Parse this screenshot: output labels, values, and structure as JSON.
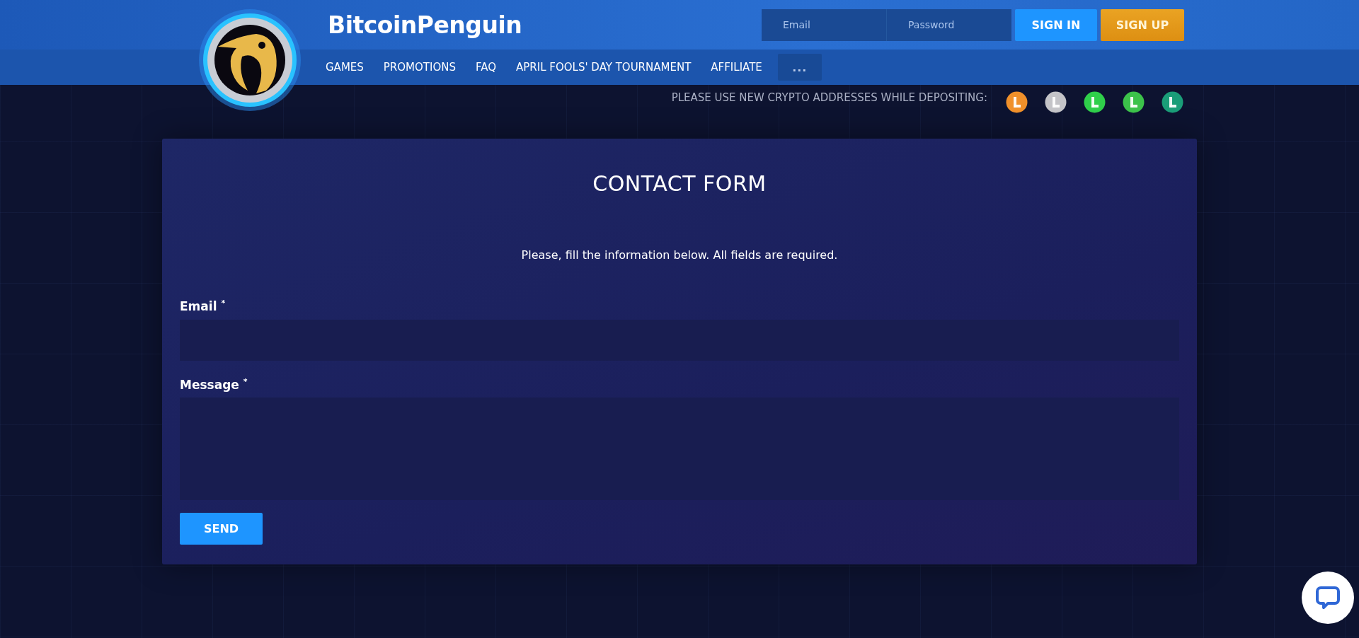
{
  "header": {
    "brand": "BitcoinPenguin",
    "login": {
      "email_placeholder": "Email",
      "password_placeholder": "Password",
      "sign_in": "SIGN IN",
      "sign_up": "SIGN UP"
    },
    "nav": [
      {
        "label": "GAMES"
      },
      {
        "label": "PROMOTIONS"
      },
      {
        "label": "FAQ"
      },
      {
        "label": "APRIL FOOLS' DAY TOURNAMENT"
      },
      {
        "label": "AFFILIATE"
      }
    ],
    "more": "..."
  },
  "notice": {
    "text": "PLEASE USE NEW CRYPTO ADDRESSES WHILE DEPOSITING:",
    "coins": [
      {
        "color": "#f0902a"
      },
      {
        "color": "#c4c4c8"
      },
      {
        "color": "#2fcf4a"
      },
      {
        "color": "#3cc24a"
      },
      {
        "color": "#1a9d78"
      }
    ]
  },
  "form": {
    "title": "CONTACT FORM",
    "instructions": "Please, fill the information below. All fields are required.",
    "fields": [
      {
        "kind": "input",
        "label": "Email $^{*}$"
      },
      {
        "kind": "textarea",
        "label": "Message $^{*}$"
      }
    ],
    "submit": "SEND"
  }
}
